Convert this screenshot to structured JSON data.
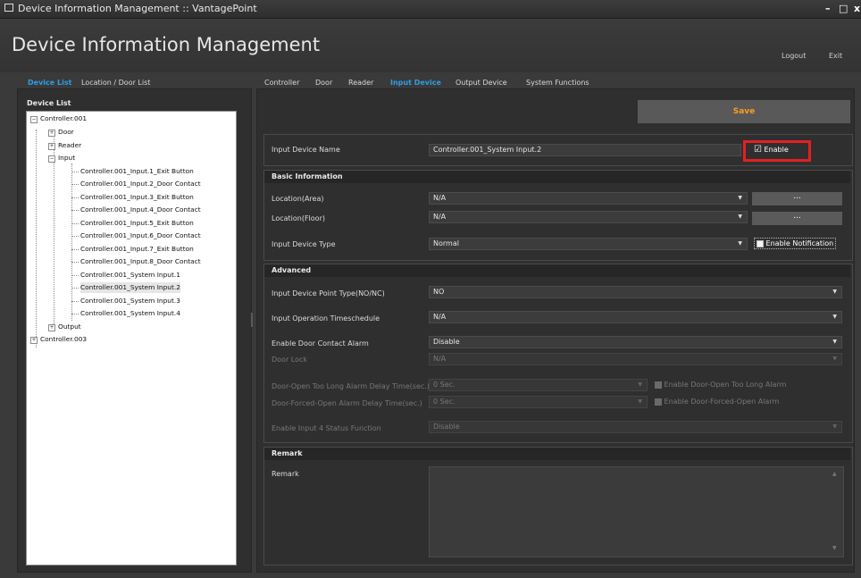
{
  "window": {
    "title": "Device Information Management :: VantagePoint",
    "controls": [
      "–",
      "□",
      "x"
    ]
  },
  "header": {
    "title": "Device Information Management",
    "logout": "Logout",
    "exit": "Exit"
  },
  "left_tabs": [
    "Device List",
    "Location / Door List"
  ],
  "right_tabs": [
    "Controller",
    "Door",
    "Reader",
    "Input Device",
    "Output Device",
    "System Functions"
  ],
  "device_list": {
    "caption": "Device List",
    "tree": [
      {
        "label": "Controller.001",
        "toggle": "−"
      },
      {
        "label": "Door",
        "toggle": "+"
      },
      {
        "label": "Reader",
        "toggle": "+"
      },
      {
        "label": "Input",
        "toggle": "−"
      },
      {
        "label": "Controller.001_Input.1_Exit Button"
      },
      {
        "label": "Controller.001_Input.2_Door Contact"
      },
      {
        "label": "Controller.001_Input.3_Exit Button"
      },
      {
        "label": "Controller.001_Input.4_Door Contact"
      },
      {
        "label": "Controller.001_Input.5_Exit Button"
      },
      {
        "label": "Controller.001_Input.6_Door Contact"
      },
      {
        "label": "Controller.001_Input.7_Exit Button"
      },
      {
        "label": "Controller.001_Input.8_Door Contact"
      },
      {
        "label": "Controller.001_System Input.1"
      },
      {
        "label": "Controller.001_System Input.2",
        "selected": true
      },
      {
        "label": "Controller.001_System Input.3"
      },
      {
        "label": "Controller.001_System Input.4"
      },
      {
        "label": "Output",
        "toggle": "+"
      },
      {
        "label": "Controller.003",
        "toggle": "+"
      }
    ]
  },
  "form": {
    "save_label": "Save",
    "input_device_name": {
      "label": "Input Device Name",
      "value": "Controller.001_System Input.2",
      "enable_label": "Enable",
      "enable_checked": true
    },
    "basic_info": {
      "title": "Basic Information",
      "location_area": {
        "label": "Location(Area)",
        "value": "N/A",
        "button": "..."
      },
      "location_floor": {
        "label": "Location(Floor)",
        "value": "N/A",
        "button": "..."
      },
      "input_device_type": {
        "label": "Input Device Type",
        "value": "Normal",
        "notification_label": "Enable Notification"
      }
    },
    "advanced": {
      "title": "Advanced",
      "point_type": {
        "label": "Input Device Point Type(NO/NC)",
        "value": "NO"
      },
      "timeschedule": {
        "label": "Input Operation Timeschedule",
        "value": "N/A"
      },
      "door_contact_alarm": {
        "label": "Enable Door Contact Alarm",
        "value": "Disable"
      },
      "door_lock": {
        "label": "Door Lock",
        "value": "N/A"
      },
      "open_too_long": {
        "label": "Door-Open Too Long Alarm Delay Time(sec.)",
        "value": "0 Sec.",
        "check_label": "Enable Door-Open Too Long Alarm"
      },
      "forced_open": {
        "label": "Door-Forced-Open Alarm Delay Time(sec.)",
        "value": "0 Sec.",
        "check_label": "Enable Door-Forced-Open Alarm"
      },
      "input4_status": {
        "label": "Enable Input 4 Status Function",
        "value": "Disable"
      }
    },
    "remark": {
      "title": "Remark",
      "label": "Remark",
      "value": ""
    }
  },
  "colors": {
    "accent_tab": "#2a9fe6",
    "save_text": "#ff9c1f",
    "highlight": "#e42020",
    "background": "#3a3a3a"
  }
}
